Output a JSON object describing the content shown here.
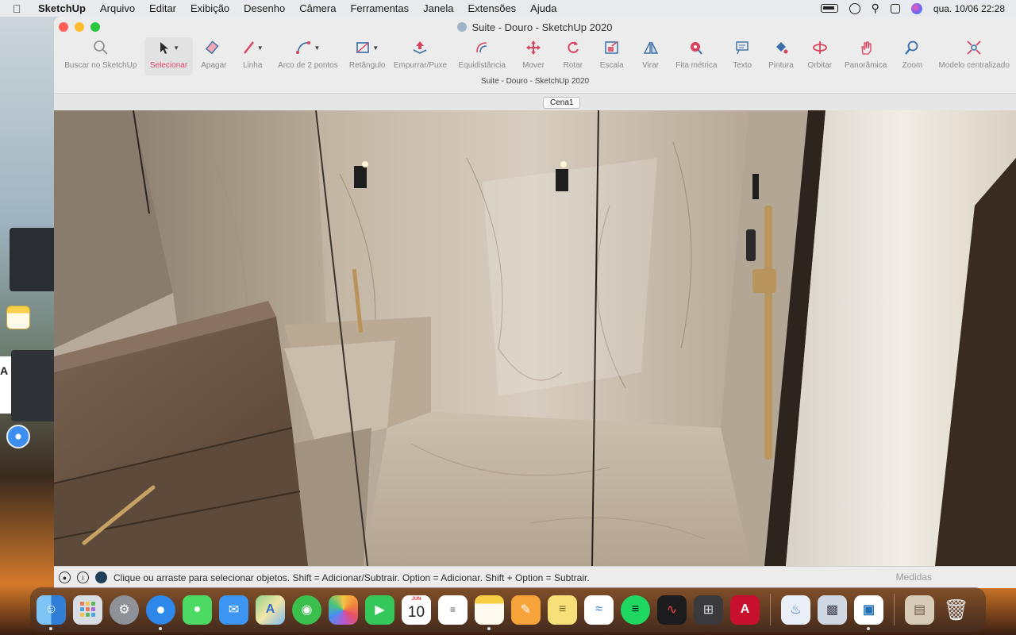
{
  "menubar": {
    "app_name": "SketchUp",
    "items": [
      "Arquivo",
      "Editar",
      "Exibição",
      "Desenho",
      "Câmera",
      "Ferramentas",
      "Janela",
      "Extensões",
      "Ajuda"
    ],
    "clock": "qua. 10/06  22:28"
  },
  "window": {
    "title": "Suite - Douro - SketchUp 2020",
    "subtitle": "Suite - Douro - SketchUp 2020",
    "scene_tab": "Cena1"
  },
  "toolbar": {
    "tools": [
      {
        "label": "Buscar no SketchUp",
        "icon": "search-icon"
      },
      {
        "label": "Selecionar",
        "icon": "select-arrow-icon",
        "active": true
      },
      {
        "label": "Apagar",
        "icon": "eraser-icon"
      },
      {
        "label": "Linha",
        "icon": "pencil-icon"
      },
      {
        "label": "Arco de 2 pontos",
        "icon": "arc-icon"
      },
      {
        "label": "Retângulo",
        "icon": "rectangle-icon"
      },
      {
        "label": "Empurrar/Puxe",
        "icon": "push-pull-icon"
      },
      {
        "label": "Equidistância",
        "icon": "offset-icon"
      },
      {
        "label": "Mover",
        "icon": "move-icon"
      },
      {
        "label": "Rotar",
        "icon": "rotate-icon"
      },
      {
        "label": "Escala",
        "icon": "scale-icon"
      },
      {
        "label": "Virar",
        "icon": "flip-icon"
      },
      {
        "label": "Fita métrica",
        "icon": "tape-measure-icon"
      },
      {
        "label": "Texto",
        "icon": "text-icon"
      },
      {
        "label": "Pintura",
        "icon": "paint-bucket-icon"
      },
      {
        "label": "Orbitar",
        "icon": "orbit-icon"
      },
      {
        "label": "Panorâmica",
        "icon": "pan-hand-icon"
      },
      {
        "label": "Zoom",
        "icon": "zoom-icon"
      },
      {
        "label": "Modelo centralizado",
        "icon": "zoom-extents-icon"
      }
    ]
  },
  "status": {
    "message": "Clique ou arraste para selecionar objetos. Shift = Adicionar/Subtrair. Option = Adicionar. Shift + Option = Subtrair.",
    "measures_label": "Medidas"
  },
  "dock": {
    "calendar_month": "JUN",
    "calendar_day": "10",
    "apps": [
      "finder",
      "launchpad",
      "system-settings",
      "safari",
      "messages",
      "mail",
      "maps",
      "find-my",
      "photos",
      "facetime",
      "calendar",
      "reminders",
      "notes",
      "pages",
      "stickies",
      "freeform",
      "spotify",
      "voice-memos",
      "calculator",
      "autocad",
      "keynote-like",
      "preview-like",
      "sketchup",
      "downloads",
      "trash"
    ]
  },
  "colors": {
    "accent_active": "#e0476a",
    "traffic_close": "#ff5f57",
    "traffic_min": "#febc2e",
    "traffic_max": "#28c840"
  }
}
